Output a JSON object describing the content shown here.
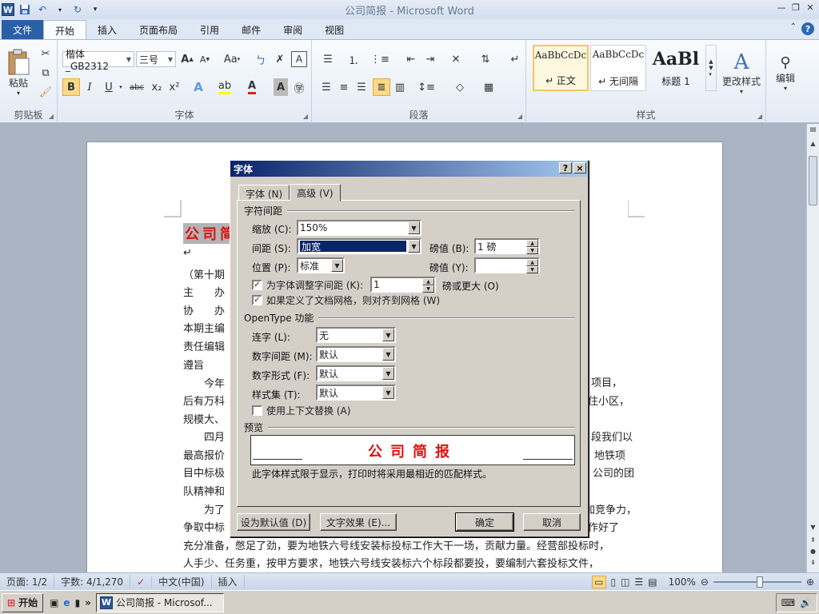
{
  "window": {
    "title": "公司简报 - Microsoft Word"
  },
  "quick_access": {
    "word_letter": "W",
    "save_icon": "save-icon",
    "undo_icon": "undo-icon",
    "redo_icon": "redo-icon"
  },
  "tabs": [
    {
      "label": "文件"
    },
    {
      "label": "开始"
    },
    {
      "label": "插入"
    },
    {
      "label": "页面布局"
    },
    {
      "label": "引用"
    },
    {
      "label": "邮件"
    },
    {
      "label": "审阅"
    },
    {
      "label": "视图"
    }
  ],
  "ribbon": {
    "clipboard": {
      "paste_label": "粘贴",
      "group_label": "剪贴板"
    },
    "font": {
      "font_name": "楷体_GB2312",
      "font_size": "三号",
      "group_label": "字体",
      "grow": "A",
      "shrink": "A",
      "change_case": "Aa",
      "bold": "B",
      "italic": "I",
      "underline": "U",
      "strike": "abc",
      "sub": "x₂",
      "sup": "x²"
    },
    "paragraph": {
      "group_label": "段落"
    },
    "styles": {
      "group_label": "样式",
      "items": [
        {
          "sample": "AaBbCcDc",
          "name": "↵ 正文"
        },
        {
          "sample": "AaBbCcDc",
          "name": "↵ 无间隔"
        },
        {
          "sample": "AaBl",
          "name": "标题 1"
        }
      ],
      "change_styles": "更改样式"
    },
    "editing": {
      "label": "编辑"
    }
  },
  "document": {
    "title_text": "公司简",
    "lines": [
      {
        "text": "↵"
      },
      {
        "text": "（第十期"
      },
      {
        "text": "主　　办"
      },
      {
        "text": "协　　办"
      },
      {
        "text": "本期主编"
      },
      {
        "text": "责任编辑"
      },
      {
        "text": "遵旨"
      },
      {
        "text": "　　今年"
      },
      {
        "text": "后有万科"
      },
      {
        "text": "规模大、"
      },
      {
        "text": "　　四月"
      },
      {
        "text": "最高报价"
      },
      {
        "text": "目中标极"
      },
      {
        "text": "队精神和"
      },
      {
        "text": "　　为了"
      },
      {
        "text": "争取中标"
      },
      {
        "text": "充分准备，憋足了劲，要为地铁六号线安装标投标工作大干一场，贡献力量。经营部投标时，"
      },
      {
        "text": "人手少、任务重，按甲方要求，地铁六号线安装标六个标段都要投，要编制六套投标文件，"
      }
    ],
    "right_fragments": [
      {
        "text": "项目，"
      },
      {
        "text": "住小区，"
      },
      {
        "text": "段我们以"
      },
      {
        "text": "地铁项"
      },
      {
        "text": "公司的团"
      },
      {
        "text": "加竞争力，"
      },
      {
        "text": "作好了"
      }
    ]
  },
  "status": {
    "page": "页面: 1/2",
    "words": "字数: 4/1,270",
    "language": "中文(中国)",
    "insert": "插入",
    "zoom": "100%"
  },
  "taskbar": {
    "start": "开始",
    "task": "公司简报 - Microsof..."
  },
  "dialog": {
    "title": "字体",
    "help": "?",
    "close": "×",
    "tabs": [
      {
        "label": "字体 (N)"
      },
      {
        "label": "高级 (V)"
      }
    ],
    "char_spacing": {
      "section": "字符间距",
      "scale_label": "缩放 (C):",
      "scale_value": "150%",
      "spacing_label": "间距 (S):",
      "spacing_value": "加宽",
      "spacing_by_label": "磅值 (B):",
      "spacing_by_value": "1 磅",
      "position_label": "位置 (P):",
      "position_value": "标准",
      "position_by_label": "磅值 (Y):",
      "position_by_value": "",
      "kerning_label": "为字体调整字间距 (K):",
      "kerning_value": "1",
      "kerning_suffix": "磅或更大 (O)",
      "kerning_checked": true,
      "grid_label": "如果定义了文档网格，则对齐到网格 (W)",
      "grid_checked": true
    },
    "opentype": {
      "section": "OpenType 功能",
      "ligatures_label": "连字 (L):",
      "ligatures_value": "无",
      "num_spacing_label": "数字间距 (M):",
      "num_spacing_value": "默认",
      "num_forms_label": "数字形式 (F):",
      "num_forms_value": "默认",
      "style_sets_label": "样式集 (T):",
      "style_sets_value": "默认",
      "contextual_label": "使用上下文替换 (A)",
      "contextual_checked": false
    },
    "preview": {
      "section": "预览",
      "text": "公司简报",
      "note": "此字体样式限于显示，打印时将采用最相近的匹配样式。"
    },
    "buttons": {
      "set_default": "设为默认值 (D)",
      "text_effects": "文字效果 (E)...",
      "ok": "确定",
      "cancel": "取消"
    }
  }
}
